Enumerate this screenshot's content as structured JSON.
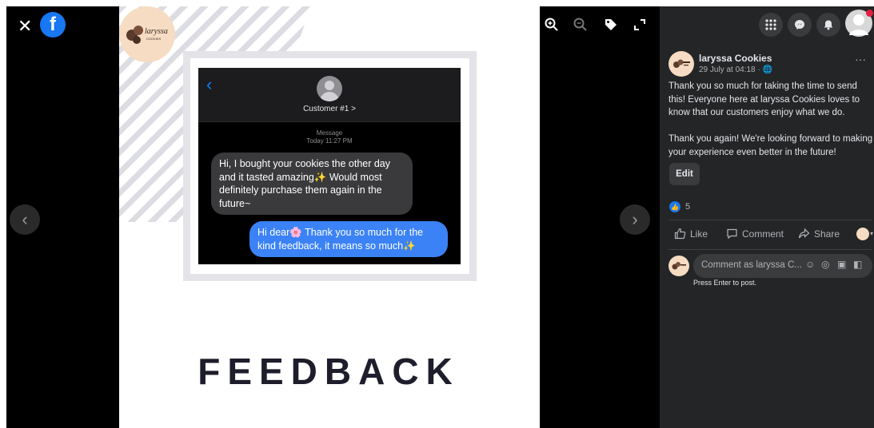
{
  "left_viewer": {
    "close_icon": "close-icon",
    "app_logo": "facebook-logo",
    "prev_icon": "chevron-left-icon"
  },
  "photo": {
    "brand_logo_text": "laryssa",
    "brand_logo_sub": "COOKIES",
    "chat": {
      "contact_name": "Customer #1 >",
      "meta_line1": "Message",
      "meta_line2": "Today 11:27 PM",
      "incoming": "Hi, I bought your cookies the other day and it tasted amazing✨ Would most definitely purchase them again in the future~",
      "outgoing": "Hi dear🌸 Thank you so much for the kind feedback, it means so much✨"
    },
    "title": "FEEDBACK"
  },
  "right_viewer": {
    "toolbar": [
      "zoom-in-icon",
      "zoom-out-icon",
      "tag-icon",
      "fullscreen-icon"
    ],
    "next_icon": "chevron-right-icon"
  },
  "panel": {
    "top_buttons": [
      "menu-grid-icon",
      "messenger-icon",
      "notifications-icon",
      "profile-avatar"
    ],
    "post": {
      "page_name": "laryssa Cookies",
      "date": "29 July at 04:18 · 🌐",
      "more": "···",
      "paragraph1": "Thank you so much for taking the time to send this! Everyone here at laryssa Cookies loves to know that our customers enjoy what we do.",
      "paragraph2": "Thank you again! We're looking forward to making your experience even better in the future!",
      "edit_label": "Edit",
      "like_count": "5"
    },
    "actions": {
      "like": "Like",
      "comment": "Comment",
      "share": "Share"
    },
    "comment_placeholder": "Comment as laryssa C...",
    "press_enter": "Press Enter to post.",
    "colors": {
      "panel_bg": "#242526",
      "accent": "#1877f2",
      "bubble_out": "#3b82f6"
    }
  }
}
